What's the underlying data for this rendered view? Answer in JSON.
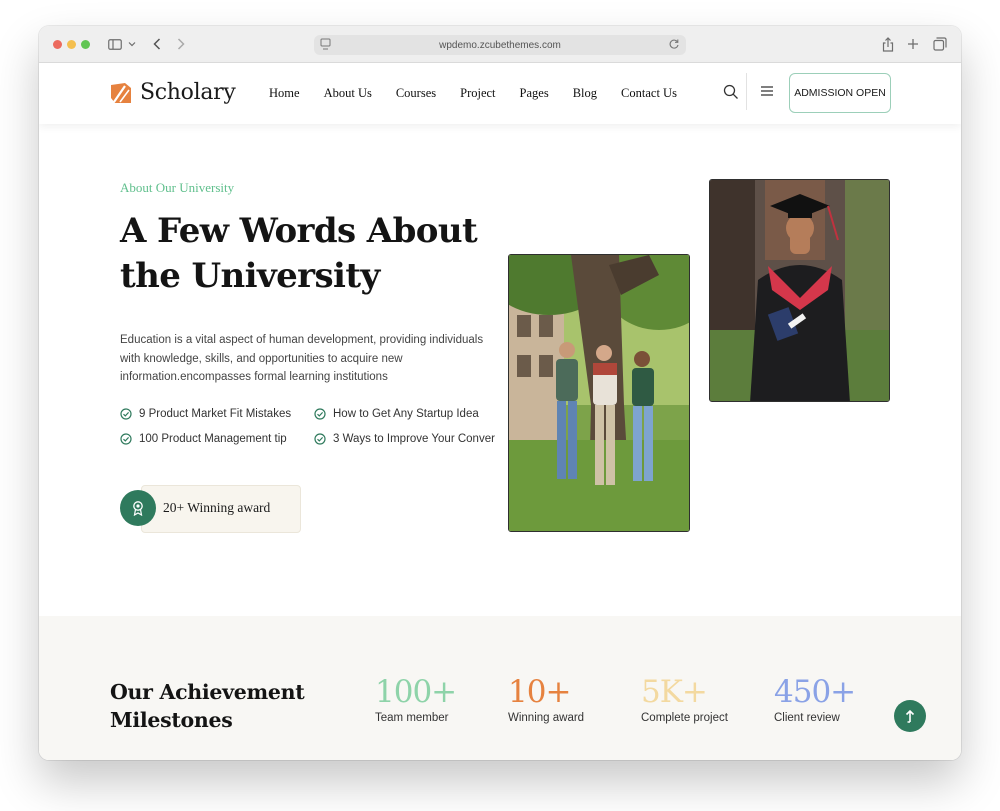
{
  "browser": {
    "url": "wpdemo.zcubethemes.com"
  },
  "site": {
    "logo_text": "Scholary",
    "menu": [
      "Home",
      "About Us",
      "Courses",
      "Project",
      "Pages",
      "Blog",
      "Contact Us"
    ],
    "cta_label": "ADMISSION OPEN"
  },
  "about": {
    "eyebrow": "About Our University",
    "headline_line1": "A Few Words About",
    "headline_line2": "the University",
    "intro": "Education is a vital aspect of human development, providing individuals with knowledge, skills, and opportunities to acquire new information.encompasses formal learning institutions",
    "checks": [
      "9 Product Market Fit Mistakes",
      "How to Get Any Startup Idea",
      "100 Product Management tip",
      "3 Ways to Improve Your Conver"
    ],
    "award_label": "20+ Winning award"
  },
  "milestones": {
    "title_line1": "Our Achievement",
    "title_line2": "Milestones",
    "stats": [
      {
        "value": "100+",
        "label": "Team member",
        "color": "#8ed3a9"
      },
      {
        "value": "10+",
        "label": "Winning award",
        "color": "#e6823f"
      },
      {
        "value": "5K+",
        "label": "Complete project",
        "color": "#f3d9a0"
      },
      {
        "value": "450+",
        "label": "Client review",
        "color": "#8aa2e6"
      }
    ]
  },
  "colors": {
    "accent_green": "#2f7a5d",
    "eyebrow_green": "#5fbf8c",
    "brand_orange": "#e6823f"
  },
  "icons": [
    "sidebar-icon",
    "chevron-down-icon",
    "back-icon",
    "forward-icon",
    "reload-icon",
    "share-icon",
    "new-tab-icon",
    "tabs-icon",
    "search-icon",
    "menu-icon",
    "check-circle-icon",
    "award-icon",
    "arrow-up-icon"
  ]
}
